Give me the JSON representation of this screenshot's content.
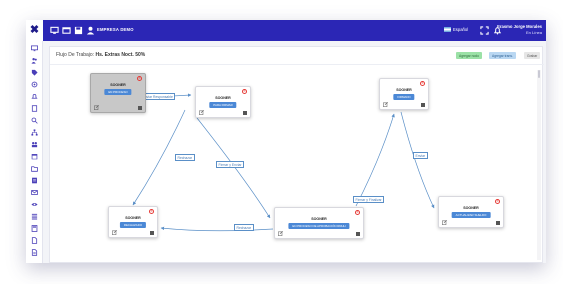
{
  "topbar": {
    "company": "EMPRESA DEMO",
    "language": "Español",
    "user_name": "Erasmo Jorge Morales",
    "user_status": "En Línea"
  },
  "panel": {
    "title_prefix": "Flujo De Trabajo:",
    "title_value": "Hs. Extras Noct. 50%",
    "buttons": [
      {
        "label": "Agregar nodo",
        "bg": "#9be1a6",
        "fg": "#2d6a3a"
      },
      {
        "label": "Agregar trans.",
        "bg": "#b9d7f2",
        "fg": "#2b5f93"
      },
      {
        "label": "Grabar",
        "bg": "#e6e6e6",
        "fg": "#555555"
      }
    ]
  },
  "nodes": [
    {
      "name": "SOONER",
      "state": "EN PROCESO",
      "selected": true
    },
    {
      "name": "SOONER",
      "state": "PARA FIRMAR",
      "selected": false
    },
    {
      "name": "SOONER",
      "state": "FIRMADO",
      "selected": false
    },
    {
      "name": "SOONER",
      "state": "RECHAZADO",
      "selected": false
    },
    {
      "name": "SOONER",
      "state": "EN PROCESO DE APROBACIÓN RRHH",
      "selected": false
    },
    {
      "name": "SOONER",
      "state": "ACTUALIZAR SUELDO",
      "selected": false
    }
  ],
  "edge_labels": [
    "Enviar Responsable",
    "Rechazar",
    "Firmar y Enviar",
    "Rechazar",
    "Firmar y Finalizar",
    "Enviar"
  ],
  "colors": {
    "topbar": "#2b26b5",
    "accent": "#4b88d6",
    "edge": "#5a8fc7",
    "delete": "#e53935"
  }
}
